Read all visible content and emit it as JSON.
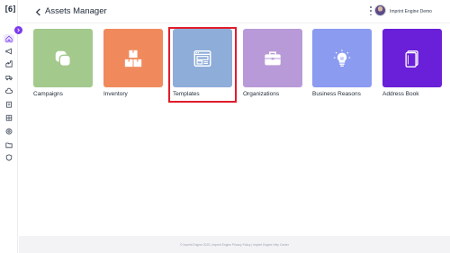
{
  "sidebar": {
    "logo_text": "[6]",
    "icons": [
      "home-icon",
      "megaphone-icon",
      "factory-icon",
      "truck-icon",
      "cloud-icon",
      "clipboard-icon",
      "grid-icon",
      "at-sign-icon",
      "folder-icon",
      "shield-icon"
    ],
    "active_index": 0
  },
  "header": {
    "title": "Assets Manager",
    "user_name": "Imprint Engine Demo"
  },
  "cards": [
    {
      "label": "Campaigns",
      "color": "#a3c98d",
      "icon": "overlap-shapes-icon"
    },
    {
      "label": "Inventory",
      "color": "#f08a5d",
      "icon": "boxes-icon"
    },
    {
      "label": "Templates",
      "color": "#8fadd9",
      "icon": "browser-window-icon",
      "selected": true
    },
    {
      "label": "Organizations",
      "color": "#b99ad8",
      "icon": "briefcase-icon"
    },
    {
      "label": "Business Reasons",
      "color": "#8a9bf0",
      "icon": "lightbulb-icon"
    },
    {
      "label": "Address Book",
      "color": "#6a1fd8",
      "icon": "address-book-icon"
    }
  ],
  "footer": {
    "text": "© Imprint Engine 2025 | Imprint Engine Privacy Policy | Imprint Engine Help Center"
  },
  "colors": {
    "accent": "#7c3aed",
    "selection": "#e11d2a"
  }
}
